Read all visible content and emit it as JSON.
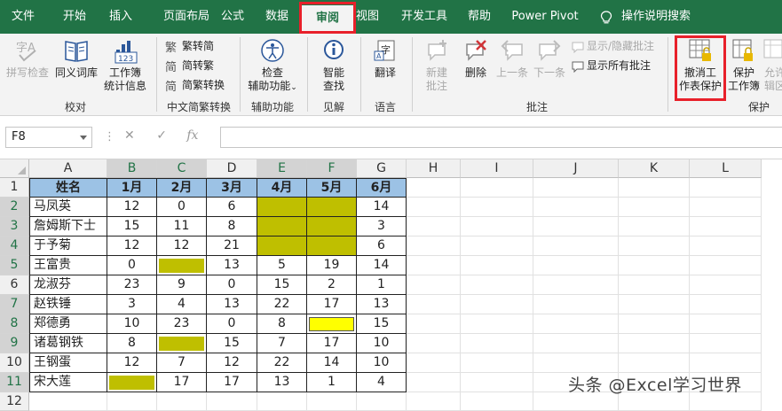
{
  "menu": {
    "tabs": [
      "文件",
      "开始",
      "插入",
      "页面布局",
      "公式",
      "数据",
      "审阅",
      "视图",
      "开发工具",
      "帮助",
      "Power Pivot"
    ],
    "active_tab": "审阅",
    "tell_me": "操作说明搜索"
  },
  "ribbon": {
    "groups": {
      "proofing": {
        "label": "校对",
        "spell_check": "拼写检查",
        "thesaurus": "同义词库",
        "workbook_stats_line1": "工作簿",
        "workbook_stats_line2": "统计信息"
      },
      "chinese_conversion": {
        "label": "中文简繁转换",
        "to_simplified": "繁转简",
        "to_traditional": "简转繁",
        "convert": "简繁转换"
      },
      "accessibility": {
        "label": "辅助功能",
        "check_line1": "检查",
        "check_line2": "辅助功能"
      },
      "insights": {
        "label": "见解",
        "smart_lookup_line1": "智能",
        "smart_lookup_line2": "查找"
      },
      "language": {
        "label": "语言",
        "translate": "翻译"
      },
      "comments": {
        "label": "批注",
        "new_line1": "新建",
        "new_line2": "批注",
        "delete": "删除",
        "previous": "上一条",
        "next": "下一条",
        "show_hide": "显示/隐藏批注",
        "show_all": "显示所有批注"
      },
      "protect": {
        "label": "保护",
        "unprotect_line1": "撤消工",
        "unprotect_line2": "作表保护",
        "protect_wb_line1": "保护",
        "protect_wb_line2": "工作簿",
        "allow_edit_line1": "允许",
        "allow_edit_line2": "辑区"
      }
    }
  },
  "formula_bar": {
    "name_box": "F8",
    "fx_label": "fx",
    "formula": ""
  },
  "sheet": {
    "columns": [
      "A",
      "B",
      "C",
      "D",
      "E",
      "F",
      "G",
      "H",
      "I",
      "J",
      "K",
      "L"
    ],
    "selected_columns": [
      "B",
      "C",
      "E",
      "F"
    ],
    "rows": [
      "1",
      "2",
      "3",
      "4",
      "5",
      "6",
      "7",
      "8",
      "9",
      "10",
      "11",
      "12"
    ],
    "selected_rows": [
      "2",
      "3",
      "4",
      "5",
      "7",
      "8",
      "9",
      "11"
    ],
    "header_row": [
      "姓名",
      "1月",
      "2月",
      "3月",
      "4月",
      "5月",
      "6月"
    ],
    "data": [
      [
        "马凤英",
        "12",
        "0",
        "6",
        "",
        "",
        "14"
      ],
      [
        "詹姆斯下士",
        "15",
        "11",
        "8",
        "",
        "",
        "3"
      ],
      [
        "于予菊",
        "12",
        "12",
        "21",
        "",
        "",
        "6"
      ],
      [
        "王富贵",
        "0",
        "",
        "13",
        "5",
        "19",
        "14"
      ],
      [
        "龙淑芬",
        "23",
        "9",
        "0",
        "15",
        "2",
        "1"
      ],
      [
        "赵铁锤",
        "3",
        "4",
        "13",
        "22",
        "17",
        "13"
      ],
      [
        "郑德勇",
        "10",
        "23",
        "0",
        "8",
        "",
        "15"
      ],
      [
        "诸葛钢铁",
        "8",
        "",
        "15",
        "7",
        "17",
        "10"
      ],
      [
        "王钢蛋",
        "12",
        "7",
        "12",
        "22",
        "14",
        "10"
      ],
      [
        "宋大莲",
        "",
        "17",
        "17",
        "13",
        "1",
        "4"
      ]
    ],
    "colors": {
      "header_fill": "#9cc2e5",
      "locked_fill": "#bfbf00",
      "active_fill": "#ffff00",
      "excel_green": "#217346",
      "highlight_outline": "#e8202a"
    }
  },
  "watermark": "头条 @Excel学习世界"
}
